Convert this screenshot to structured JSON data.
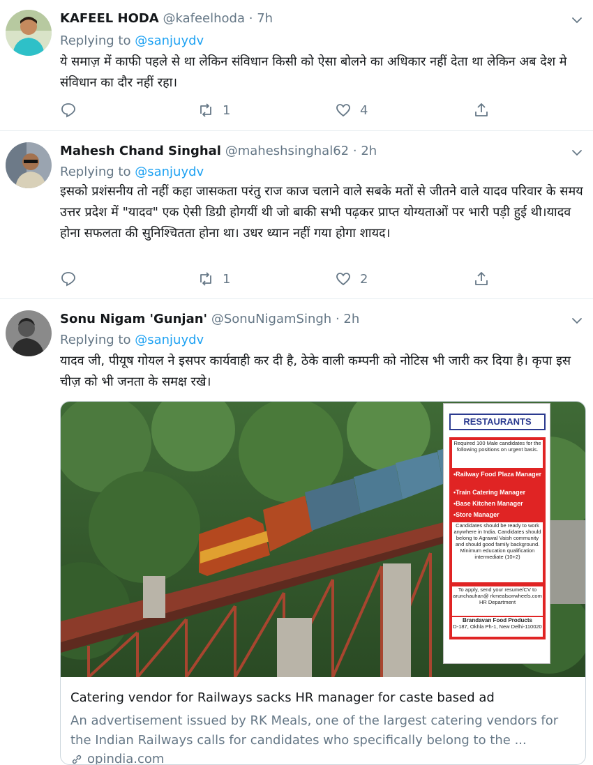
{
  "tweets": [
    {
      "name": "KAFEEL HODA",
      "handle": "@kafeelhoda",
      "time": "7h",
      "replying_prefix": "Replying to",
      "replying_to": "@sanjuydv",
      "body": "ये समाज़ में काफी पहले से था लेकिन संविधान किसी को ऐसा बोलने का अधिकार नहीं देता था  लेकिन अब देश मे संविधान का दौर नहीं रहा।",
      "retweets": "1",
      "likes": "4"
    },
    {
      "name": "Mahesh Chand Singhal",
      "handle": "@maheshsinghal62",
      "time": "2h",
      "replying_prefix": "Replying to",
      "replying_to": "@sanjuydv",
      "body": "इसको प्रशंसनीय तो नहीं कहा जासकता परंतु राज काज चलाने वाले सबके मतों से जीतने वाले यादव परिवार के समय उत्तर प्रदेश में \"यादव\" एक ऐसी डिग्री होगयीं थी जो बाकी सभी पढ़कर प्राप्त योग्यताओं पर भारी पड़ी हुई थी।यादव होना सफलता की सुनिश्चितता होना था। उधर ध्यान नहीं गया होगा शायद।",
      "retweets": "1",
      "likes": "2"
    },
    {
      "name": "Sonu Nigam 'Gunjan'",
      "handle": "@SonuNigamSingh",
      "time": "2h",
      "replying_prefix": "Replying to",
      "replying_to": "@sanjuydv",
      "body": "यादव जी, पीयूष गोयल ने इसपर कार्यवाही कर दी है, ठेके वाली कम्पनी को नोटिस भी जारी कर दिया है। कृपा इस चीज़ को भी जनता के समक्ष रखे।"
    }
  ],
  "card": {
    "title": "Catering vendor for Railways sacks HR manager for caste based ad",
    "description": "An advertisement issued by RK Meals, one of the largest catering vendors for the Indian Railways calls for candidates who specifically belong to the ...",
    "domain": "opindia.com",
    "ad": {
      "heading": "RESTAURANTS",
      "intro": "Required 100 Male candidates for the following positions on urgent basis.",
      "positions": [
        "•Railway Food Plaza Manager",
        "•Train Catering Manager",
        "•Base Kitchen Manager",
        "•Store Manager"
      ],
      "requirements": "Candidates should be ready to work anywhere in India. Candidates should belong to Agrawal Vaish community and should good family background. Minimum education qualification intermediate (10+2)",
      "apply": "To apply, send your resume/CV to arunchauhan@ rkmealsonwheels.com HR Department",
      "company": "Brandavan Food Products",
      "address": "D-187, Okhla Ph-1, New Delhi-110020"
    }
  }
}
